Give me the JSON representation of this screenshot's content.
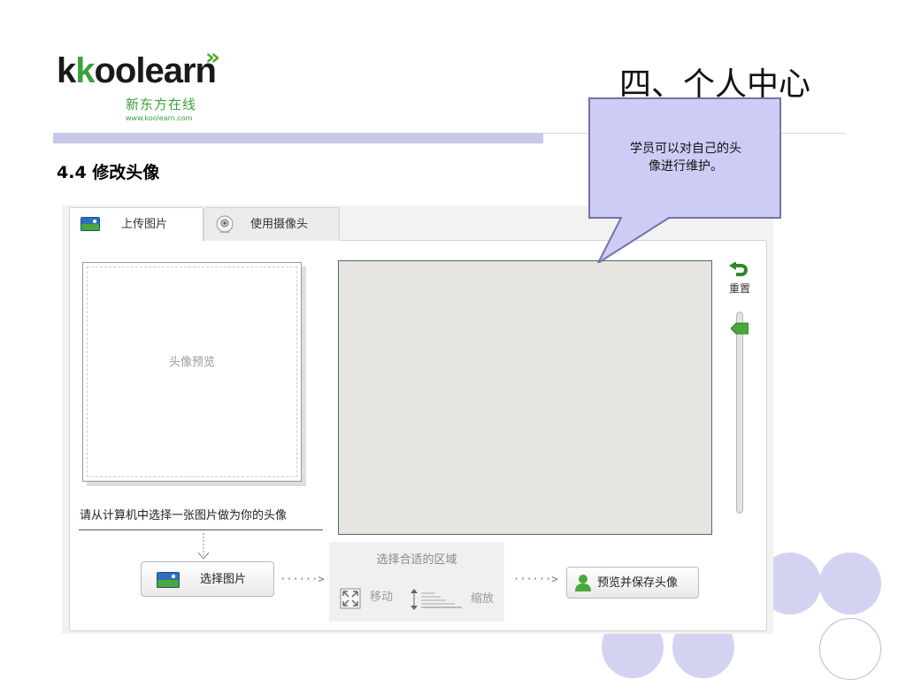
{
  "logo": {
    "word_a": "k",
    "word_b": "k",
    "word_c": "oolearn",
    "chevrons": "»",
    "chinese": "新东方在线",
    "url": "www.koolearn.com"
  },
  "slide": {
    "title": "四、个人中心",
    "section_title": "4.4 修改头像"
  },
  "callout": {
    "line1": "学员可以对自己的头",
    "line2": "像进行维护。"
  },
  "widget": {
    "tabs": [
      {
        "label": "上传图片",
        "icon": "picture-icon"
      },
      {
        "label": "使用摄像头",
        "icon": "webcam-icon"
      }
    ],
    "preview_label": "头像预览",
    "reset_label": "重置",
    "zoom_level": 0.05,
    "instruction": "请从计算机中选择一张图片做为你的头像",
    "select_button_label": "选择图片",
    "arrow_text": "······>",
    "region": {
      "title": "选择合适的区域",
      "move_label": "移动",
      "zoom_label": "缩放"
    },
    "save_button_label": "预览并保存头像"
  },
  "colors": {
    "brand_green": "#3aa23a",
    "callout_fill": "#ccccf5",
    "callout_border": "#7373a8",
    "circle_fill": "#d3d3f1",
    "crop_area": "#e7e5e0",
    "header_bar": "#c8c8e8"
  }
}
